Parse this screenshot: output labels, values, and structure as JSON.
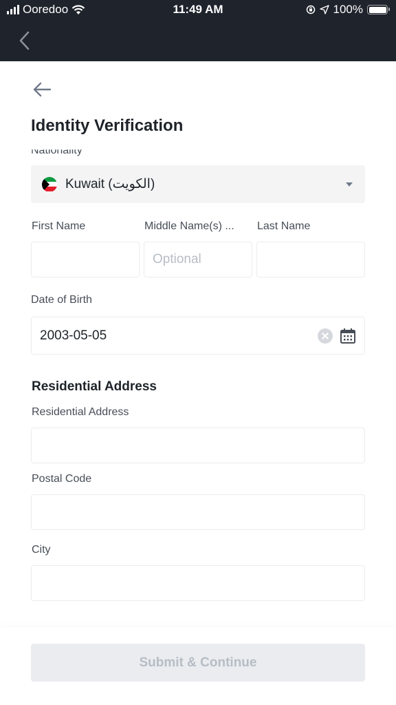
{
  "status_bar": {
    "carrier": "Ooredoo",
    "time": "11:49 AM",
    "battery": "100%"
  },
  "page": {
    "title": "Identity Verification"
  },
  "nationality": {
    "label": "Nationality",
    "value": "Kuwait (الكويت)"
  },
  "name_fields": [
    {
      "label": "First Name",
      "value": "",
      "placeholder": ""
    },
    {
      "label": "Middle Name(s) ...",
      "value": "",
      "placeholder": "Optional"
    },
    {
      "label": "Last Name",
      "value": "",
      "placeholder": ""
    }
  ],
  "dob": {
    "label": "Date of Birth",
    "value": "2003-05-05"
  },
  "address_section": {
    "title": "Residential Address",
    "fields": [
      {
        "label": "Residential Address",
        "value": ""
      },
      {
        "label": "Postal Code",
        "value": ""
      },
      {
        "label": "City",
        "value": ""
      }
    ]
  },
  "footer": {
    "submit_label": "Submit & Continue"
  }
}
